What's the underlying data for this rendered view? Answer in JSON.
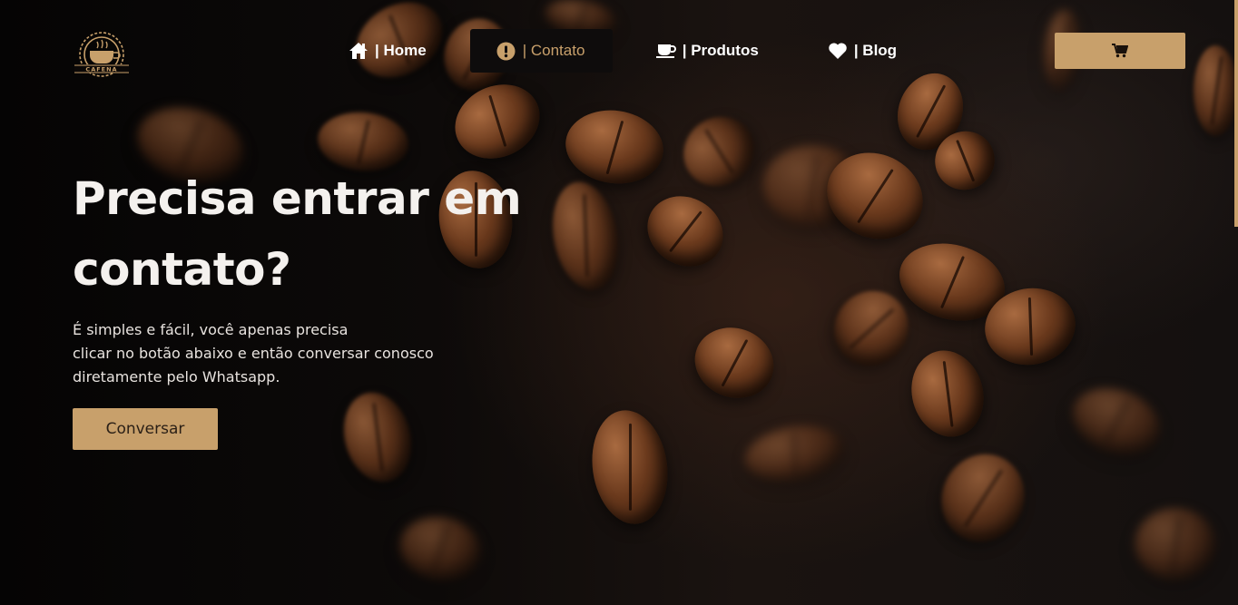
{
  "brand": {
    "logo_text": "CAFENA"
  },
  "nav": {
    "items": [
      {
        "label": "| Home",
        "icon": "home-icon"
      },
      {
        "label": "| Contato",
        "icon": "exclamation-circle-icon",
        "active": true
      },
      {
        "label": "| Produtos",
        "icon": "coffee-cup-icon"
      },
      {
        "label": "| Blog",
        "icon": "heart-icon"
      }
    ],
    "cart_icon": "shopping-cart-icon"
  },
  "hero": {
    "title_line1": "Precisa entrar em",
    "title_line2": "contato?",
    "text_line1": "É simples e fácil, você apenas precisa",
    "text_line2": "clicar no botão abaixo e então conversar conosco",
    "text_line3": "diretamente pelo Whatsapp.",
    "cta_label": "Conversar"
  },
  "colors": {
    "accent": "#c8a06b",
    "background": "#0b0807",
    "text": "#f4f1ee",
    "active_nav_bg": "#0e0c0c"
  }
}
